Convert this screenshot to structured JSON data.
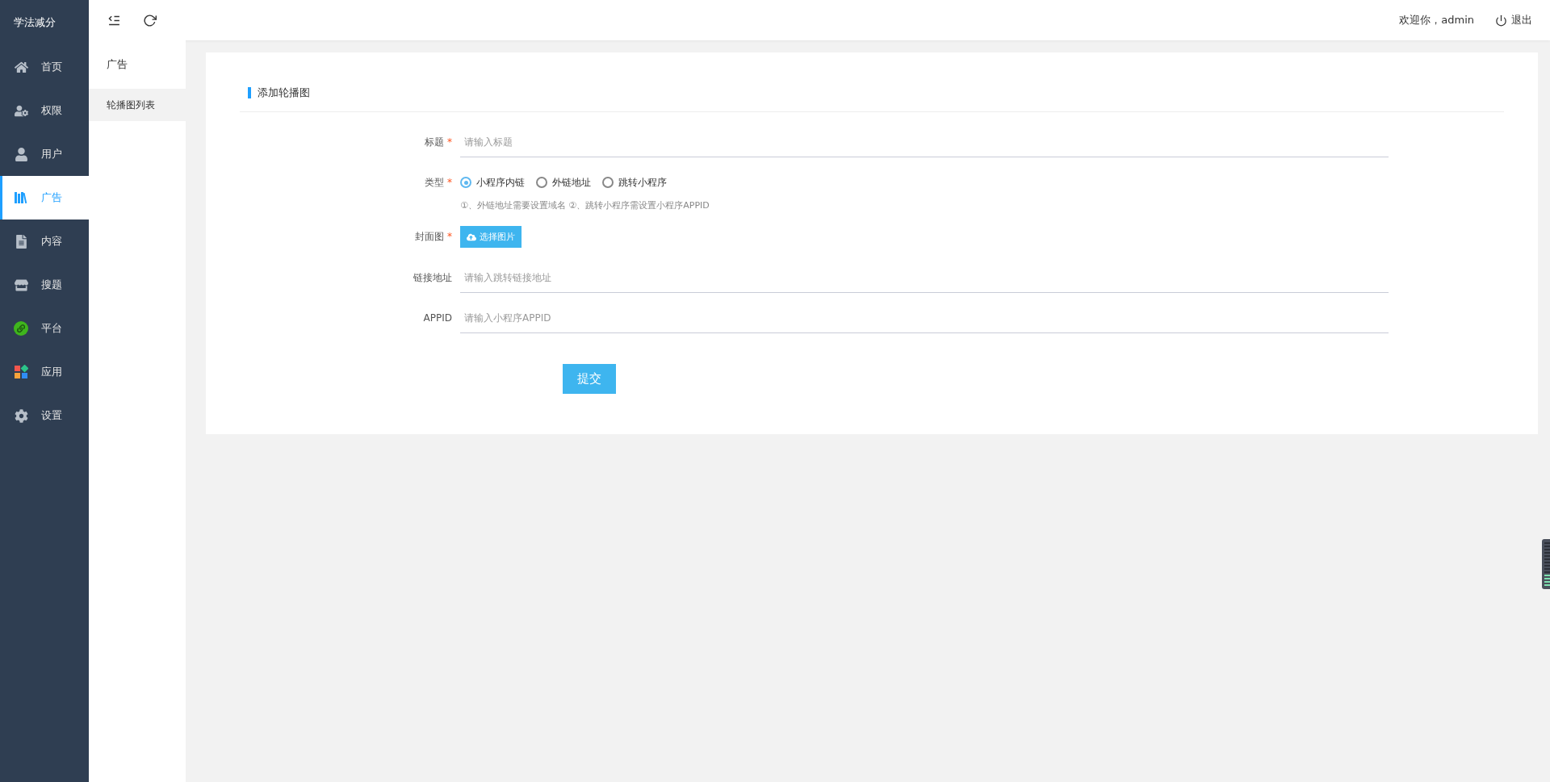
{
  "app": {
    "title": "学法减分"
  },
  "sidebar": {
    "items": [
      {
        "label": "首页",
        "selected": false
      },
      {
        "label": "权限",
        "selected": false
      },
      {
        "label": "用户",
        "selected": false
      },
      {
        "label": "广告",
        "selected": true
      },
      {
        "label": "内容",
        "selected": false
      },
      {
        "label": "搜题",
        "selected": false
      },
      {
        "label": "平台",
        "selected": false
      },
      {
        "label": "应用",
        "selected": false
      },
      {
        "label": "设置",
        "selected": false
      }
    ]
  },
  "topbar": {
    "welcome": "欢迎你，admin",
    "logout": "退出"
  },
  "submenu": {
    "title": "广告",
    "items": [
      {
        "label": "轮播图列表",
        "selected": true
      }
    ]
  },
  "form": {
    "title": "添加轮播图",
    "fields": [
      {
        "kind": "input",
        "label": "标题",
        "required_mark": "*",
        "placeholder": "请输入标题"
      },
      {
        "kind": "radio",
        "label": "类型",
        "required_mark": "*",
        "options": [
          {
            "label": "小程序内链",
            "selected": true
          },
          {
            "label": "外链地址",
            "selected": false
          },
          {
            "label": "跳转小程序",
            "selected": false
          }
        ],
        "hint": "①、外链地址需要设置域名 ②、跳转小程序需设置小程序APPID"
      },
      {
        "kind": "upload",
        "label": "封面图",
        "required_mark": "*",
        "button": "选择图片"
      },
      {
        "kind": "input",
        "label": "链接地址",
        "placeholder": "请输入跳转链接地址"
      },
      {
        "kind": "input",
        "label": "APPID",
        "placeholder": "请输入小程序APPID"
      }
    ],
    "submit": "提交"
  }
}
